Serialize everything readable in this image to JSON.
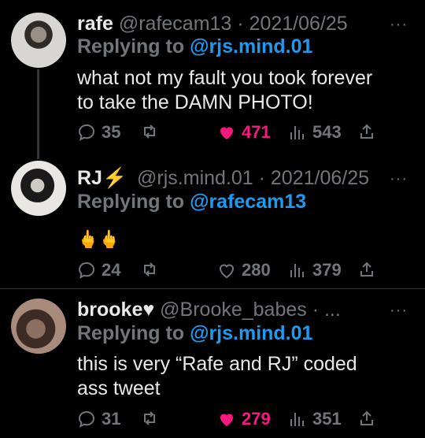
{
  "tweets": [
    {
      "name": "rafe",
      "handle_date": "@rafecam13 · 2021/06/25",
      "replying_prefix": "Replying to",
      "replying_handle": "@rjs.mind.01",
      "text_line1": "what not my fault you took forever",
      "text_line2": "to take the DAMN PHOTO!",
      "replies": "35",
      "likes": "471",
      "views": "543",
      "liked": true
    },
    {
      "name": "RJ⚡",
      "handle_date": "@rjs.mind.01 · 2021/06/25",
      "replying_prefix": "Replying to",
      "replying_handle": "@rafecam13",
      "text_line1": "🖕🖕",
      "replies": "24",
      "likes": "280",
      "views": "379",
      "liked": false
    },
    {
      "name": "brooke♥",
      "handle_date": "@Brooke_babes · ...",
      "replying_prefix": "Replying to",
      "replying_handle": "@rjs.mind.01",
      "text_line1": "this is very “Rafe and RJ” coded",
      "text_line2": "ass tweet",
      "replies": "31",
      "likes": "279",
      "views": "351",
      "liked": true
    }
  ],
  "more_label": "···",
  "colors": {
    "link": "#1d9bf0",
    "like": "#f91880",
    "muted": "#71767b"
  }
}
